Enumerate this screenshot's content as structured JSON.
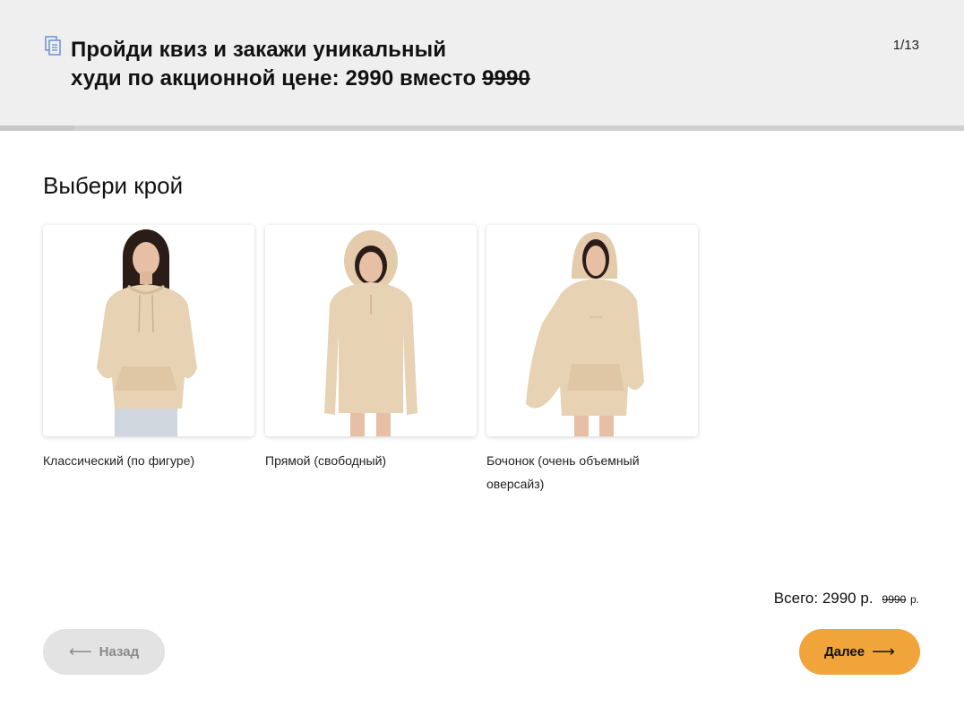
{
  "header": {
    "title_line1": "Пройди квиз и закажи уникальный",
    "title_line2_prefix": "худи по акционной цене: 2990 вместо ",
    "title_old_price": "9990",
    "step": "1/13",
    "icon": "document-icon"
  },
  "question": {
    "text": "Выбери крой"
  },
  "options": [
    {
      "label": "Классический (по фигуре)",
      "image": "hoodie-classic-image"
    },
    {
      "label": "Прямой (свободный)",
      "image": "hoodie-straight-image"
    },
    {
      "label": "Бочонок (очень объемный оверсайз)",
      "image": "hoodie-barrel-image"
    }
  ],
  "summary": {
    "total_label": "Всего: 2990 р.",
    "old_price": "9990",
    "old_currency": "р."
  },
  "nav": {
    "back_label": "Назад",
    "next_label": "Далее",
    "back_arrow": "⟵",
    "next_arrow": "⟶"
  },
  "colors": {
    "accent": "#f0a43a",
    "header_bg": "#efefef",
    "hoodie": "#e8d2b4"
  }
}
